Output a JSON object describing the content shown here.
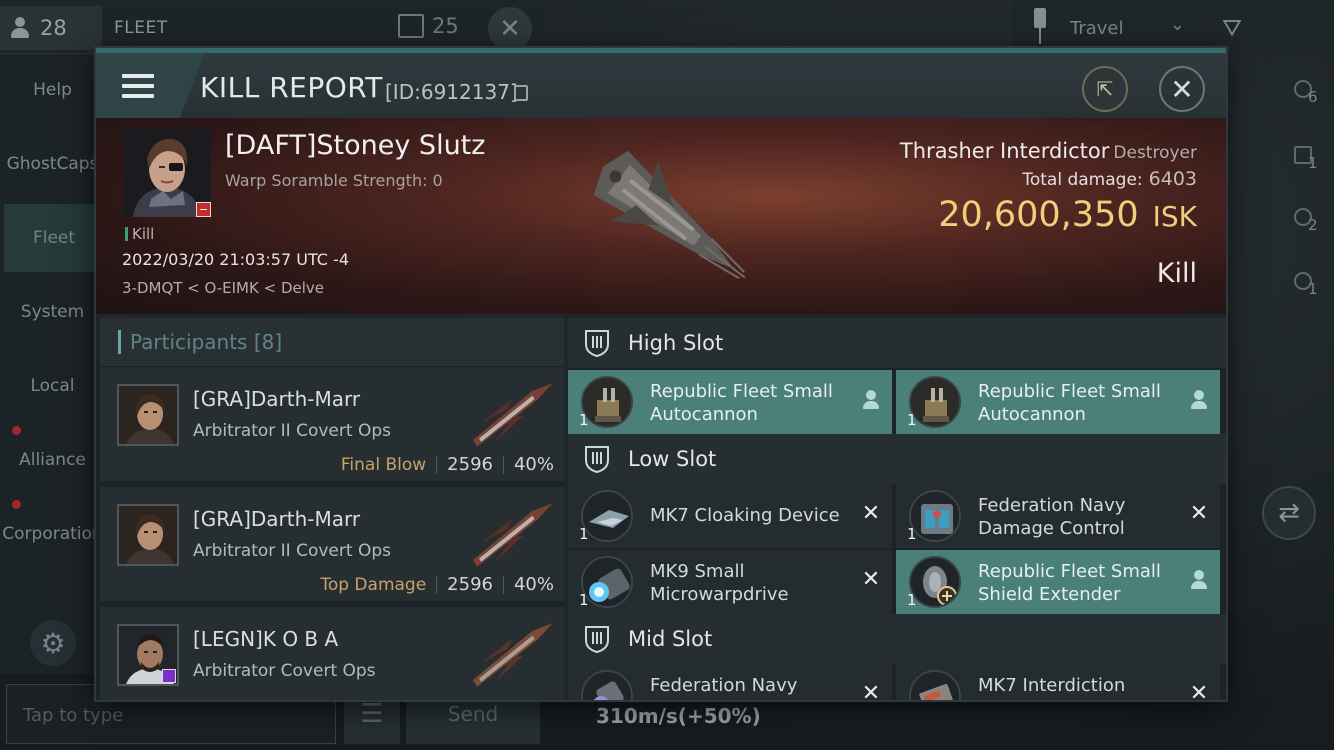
{
  "background": {
    "fleet_pilot_count": "28",
    "fleet_label": "FLEET",
    "fleet_chat_count": "25",
    "nav_items": [
      "Help",
      "GhostCaps",
      "Fleet",
      "System",
      "Local",
      "Alliance",
      "Corporation"
    ],
    "chat_placeholder": "Tap to type",
    "send_label": "Send",
    "travel_label": "Travel",
    "right_counts": [
      "6",
      "1",
      "2",
      "1"
    ],
    "speed_readout": "310m/s(+50%)"
  },
  "modal": {
    "title": "KILL REPORT",
    "id_label": "[ID:6912137]",
    "victim": {
      "name": "[DAFT]Stoney Slutz",
      "scramble": "Warp Soramble Strength: 0",
      "kill_tag": "Kill",
      "timestamp": "2022/03/20 21:03:57 UTC -4",
      "location": "3-DMQT < O-EIMK < Delve"
    },
    "ship": {
      "name": "Thrasher Interdictor",
      "class": "Destroyer",
      "total_damage_label": "Total damage:",
      "total_damage": "6403",
      "isk_value": "20,600,350",
      "isk_unit": "ISK",
      "outcome": "Kill"
    },
    "participants": {
      "label": "Participants",
      "count": "[8]",
      "rows": [
        {
          "name": "[GRA]Darth-Marr",
          "ship": "Arbitrator II Covert Ops",
          "role": "Final Blow",
          "damage": "2596",
          "percent": "40%"
        },
        {
          "name": "[GRA]Darth-Marr",
          "ship": "Arbitrator II Covert Ops",
          "role": "Top Damage",
          "damage": "2596",
          "percent": "40%"
        },
        {
          "name": "[LEGN]K O B A",
          "ship": "Arbitrator Covert Ops",
          "role": "",
          "damage": "",
          "percent": ""
        }
      ]
    },
    "fittings": {
      "high_slot_label": "High Slot",
      "low_slot_label": "Low Slot",
      "mid_slot_label": "Mid Slot",
      "high": [
        {
          "name": "Republic Fleet Small Autocannon",
          "qty": "1",
          "status": "dropped"
        },
        {
          "name": "Republic Fleet Small Autocannon",
          "qty": "1",
          "status": "dropped"
        }
      ],
      "low": [
        {
          "name": "MK7 Cloaking Device",
          "qty": "1",
          "status": "destroyed"
        },
        {
          "name": "Federation Navy Damage Control",
          "qty": "1",
          "status": "destroyed"
        },
        {
          "name": "MK9 Small Microwarpdrive",
          "qty": "1",
          "status": "destroyed"
        },
        {
          "name": "Republic Fleet Small Shield Extender",
          "qty": "1",
          "status": "dropped"
        }
      ],
      "mid": [
        {
          "name": "Federation Navy",
          "qty": "",
          "status": "destroyed"
        },
        {
          "name": "MK7 Interdiction",
          "qty": "",
          "status": "destroyed"
        }
      ],
      "destroyed_symbol": "✕"
    }
  },
  "colors": {
    "accent_teal": "#4b7f7a",
    "isk_gold": "#f1cd7c",
    "final_blow": "#c7a36a"
  }
}
